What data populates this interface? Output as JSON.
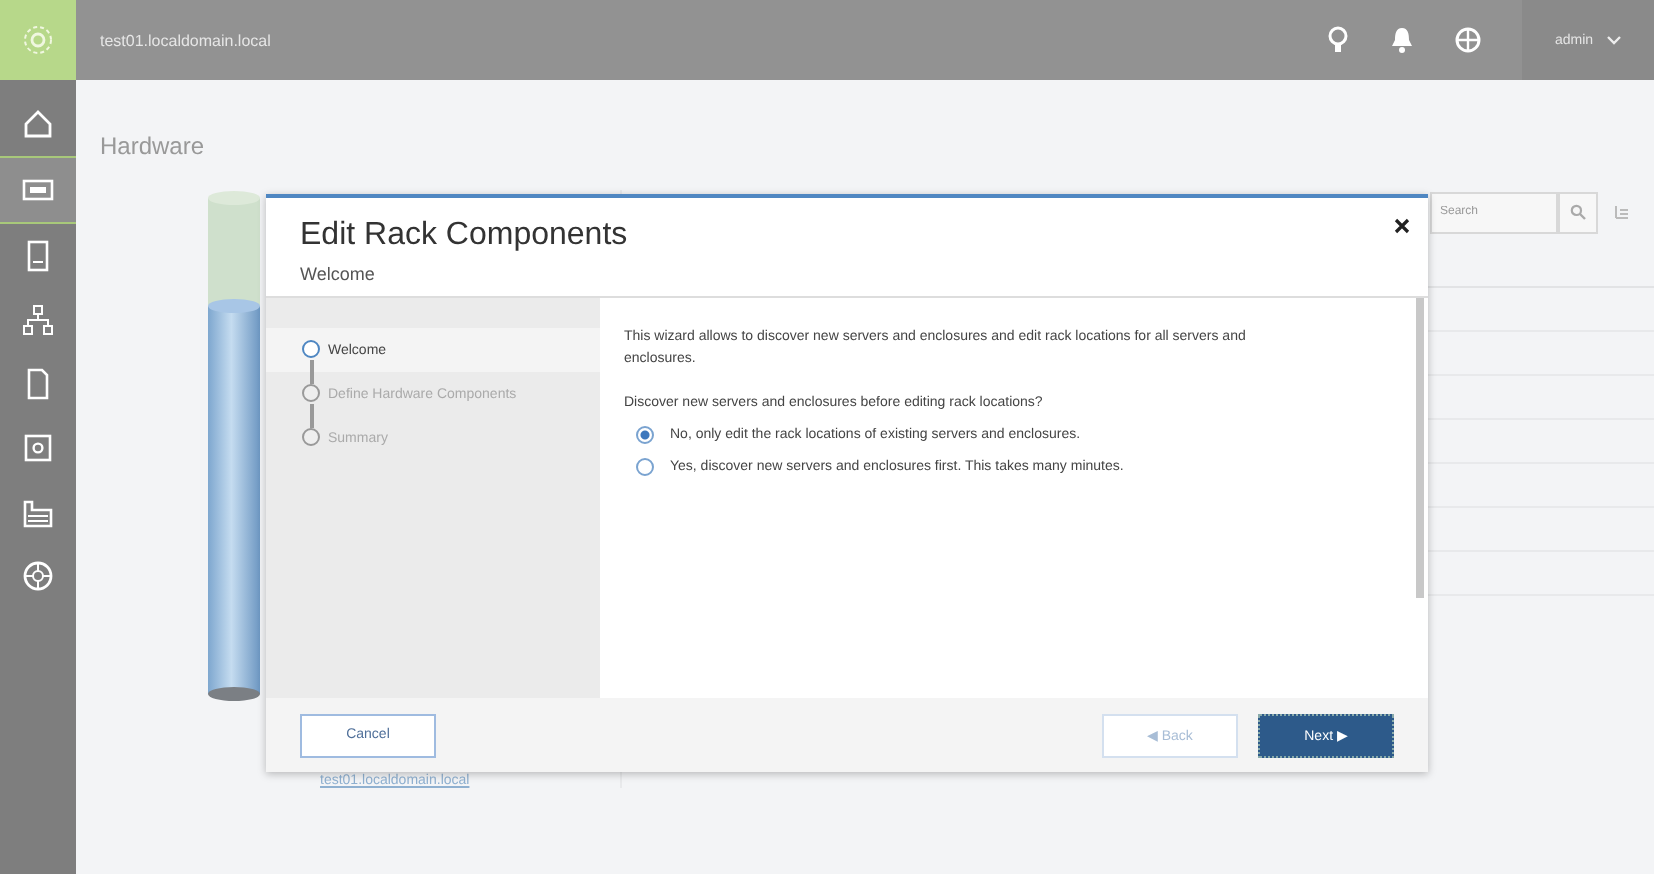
{
  "topbar": {
    "hostname": "test01.localdomain.local",
    "user": "admin"
  },
  "sidebar": {
    "items": [
      {
        "kind": "home",
        "selected": false
      },
      {
        "kind": "server",
        "selected": true
      },
      {
        "kind": "rack",
        "selected": false
      },
      {
        "kind": "network",
        "selected": false
      },
      {
        "kind": "document",
        "selected": false
      },
      {
        "kind": "safe",
        "selected": false
      },
      {
        "kind": "factory",
        "selected": false
      },
      {
        "kind": "globe",
        "selected": false
      }
    ]
  },
  "page": {
    "title": "Hardware",
    "search": {
      "placeholder": "Search"
    },
    "rack_link": "test01.localdomain.local"
  },
  "dialog": {
    "title": "Edit Rack Components",
    "subtitle": "Welcome",
    "steps": [
      {
        "label": "Welcome",
        "selected": true
      },
      {
        "label": "Define Hardware Components",
        "selected": false
      },
      {
        "label": "Summary",
        "selected": false
      }
    ],
    "intro": "This wizard allows to discover new servers and enclosures and edit rack locations for all servers and enclosures.",
    "question": "Discover new servers and enclosures before editing rack locations?",
    "options": [
      {
        "label": "No, only edit the rack locations of existing servers and enclosures.",
        "selected": true
      },
      {
        "label": "Yes, discover new servers and enclosures first. This takes many minutes.",
        "selected": false
      }
    ],
    "cancel": "Cancel",
    "back": {
      "label": "◀ Back",
      "disabled": true
    },
    "next": "Next ▶"
  }
}
